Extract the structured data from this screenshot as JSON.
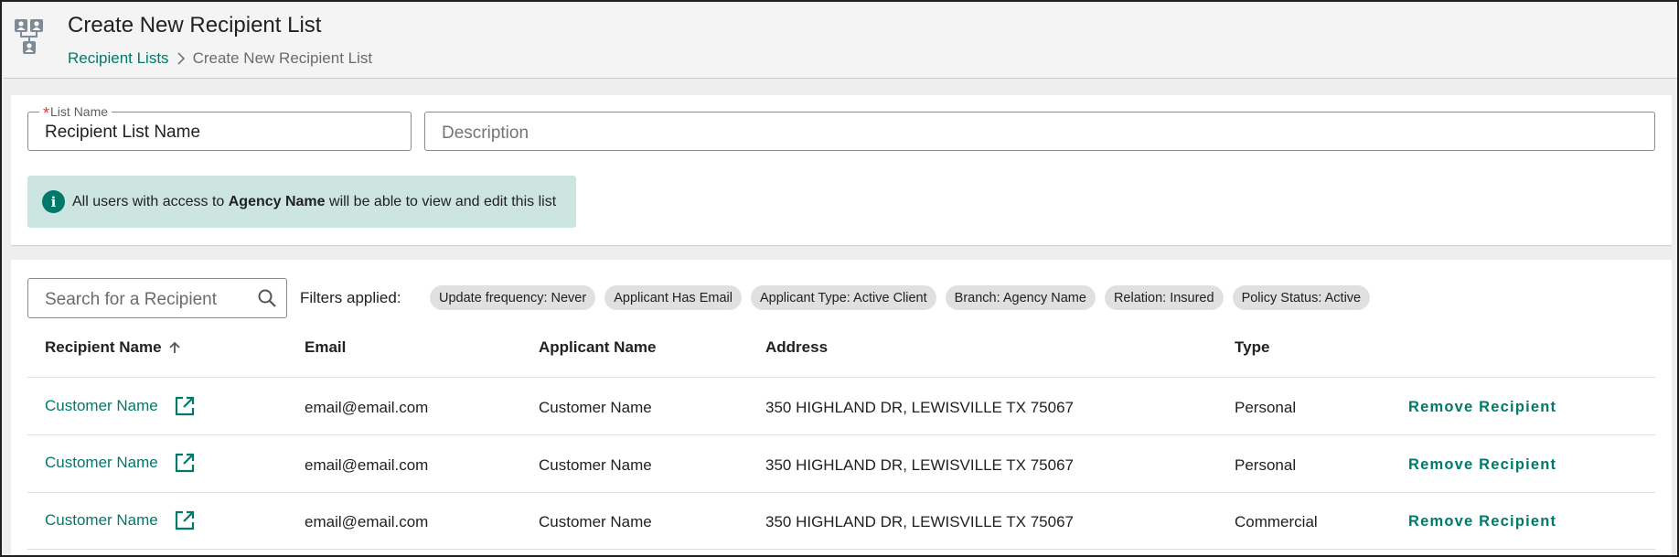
{
  "header": {
    "title": "Create New Recipient List",
    "icon": "recipient-list-icon",
    "breadcrumb": {
      "parent": "Recipient Lists",
      "current": "Create New Recipient List"
    }
  },
  "form": {
    "list_name": {
      "label": "List Name",
      "required_marker": "*",
      "value": "Recipient List Name"
    },
    "description": {
      "placeholder": "Description"
    },
    "info": {
      "icon": "info-icon",
      "text_before": "All users with access to ",
      "agency": "Agency Name",
      "text_after": " will be able to view and edit this list"
    }
  },
  "recipients": {
    "search_placeholder": "Search for a Recipient",
    "filters_label": "Filters applied:",
    "filters": [
      "Update frequency: Never",
      "Applicant Has Email",
      "Applicant Type: Active Client",
      "Branch: Agency Name",
      "Relation: Insured",
      "Policy Status: Active"
    ],
    "columns": {
      "recipient_name": "Recipient Name",
      "email": "Email",
      "applicant_name": "Applicant Name",
      "address": "Address",
      "type": "Type"
    },
    "remove_label": "Remove Recipient",
    "rows": [
      {
        "name": "Customer Name",
        "email": "email@email.com",
        "applicant": "Customer Name",
        "address": "350 HIGHLAND DR, LEWISVILLE TX 75067",
        "type": "Personal"
      },
      {
        "name": "Customer Name",
        "email": "email@email.com",
        "applicant": "Customer Name",
        "address": "350 HIGHLAND DR, LEWISVILLE TX 75067",
        "type": "Personal"
      },
      {
        "name": "Customer Name",
        "email": "email@email.com",
        "applicant": "Customer Name",
        "address": "350 HIGHLAND DR, LEWISVILLE TX 75067",
        "type": "Commercial"
      }
    ]
  },
  "colors": {
    "accent": "#00796b",
    "info_background": "#cde5e1",
    "required": "#e53935",
    "chip_background": "#e0e0e0"
  }
}
